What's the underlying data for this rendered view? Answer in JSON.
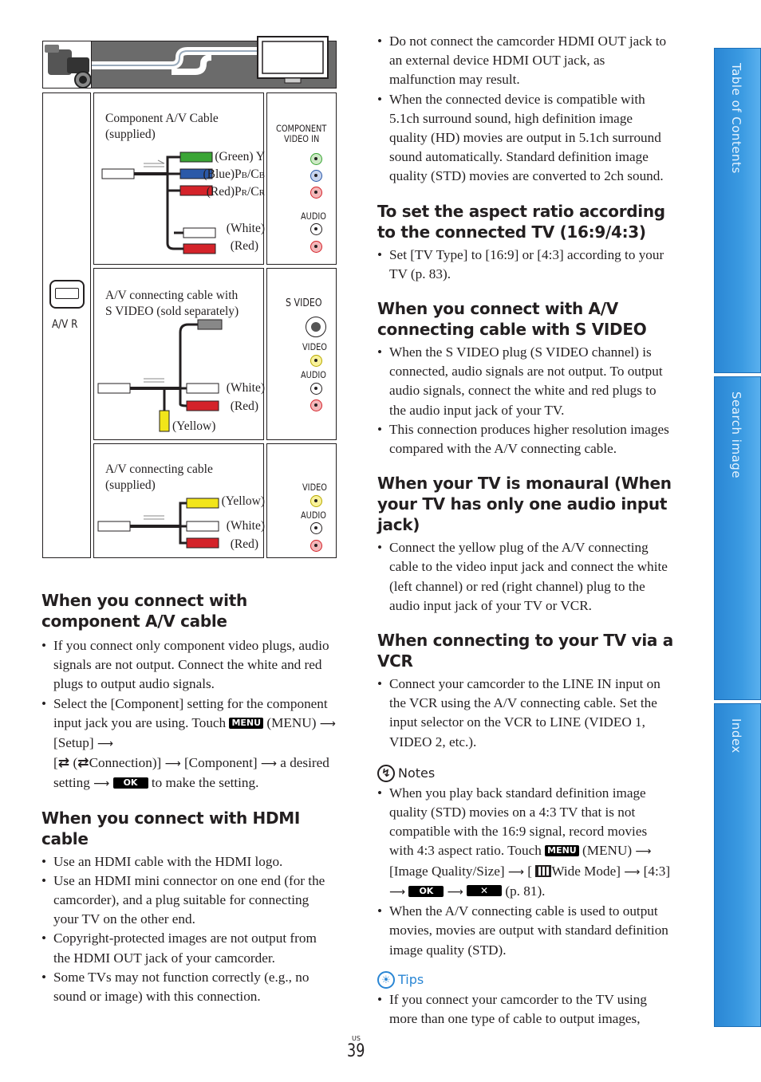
{
  "diagram": {
    "camcorder_jack": "A/V R",
    "component": {
      "cable_label_1": "Component A/V Cable",
      "cable_label_2": "(supplied)",
      "tv_label_1": "COMPONENT",
      "tv_label_2": "VIDEO IN",
      "audio_label": "AUDIO",
      "plugs": [
        "(Green) Y",
        "(Blue)P",
        "B",
        "/C",
        "B",
        "(Red)P",
        "R",
        "/C",
        "R",
        "(White)",
        "(Red)"
      ]
    },
    "svideo": {
      "cable_label_1": "A/V connecting cable with",
      "cable_label_2": "S VIDEO (sold separately)",
      "tv_svideo": "S VIDEO",
      "tv_video": "VIDEO",
      "tv_audio": "AUDIO",
      "plugs": [
        "(White)",
        "(Red)",
        "(Yellow)"
      ]
    },
    "av": {
      "cable_label_1": "A/V connecting cable",
      "cable_label_2": "(supplied)",
      "tv_video": "VIDEO",
      "tv_audio": "AUDIO",
      "plugs": [
        "(Yellow)",
        "(White)",
        "(Red)"
      ]
    },
    "colors": {
      "green": "#3aa535",
      "blue": "#2b59a8",
      "red": "#d4232a",
      "yellow": "#f2e51a",
      "white": "#ffffff",
      "banner": "#6b6b6b"
    }
  },
  "left": {
    "component": {
      "heading": "When you connect with component A/V cable",
      "b1": "If you connect only component video plugs, audio signals are not output. Connect the white and red plugs to output audio signals.",
      "b2_a": "Select the [Component] setting for the component input jack you are using. Touch",
      "menu": "MENU",
      "b2_b": "(MENU)",
      "b2_c": "[Setup]",
      "b2_d": "[",
      "b2_e": "(",
      "b2_f": "Connection)]",
      "b2_g": "[Component]",
      "b2_h": "a desired setting",
      "ok": "OK",
      "b2_i": "to make the setting."
    },
    "hdmi": {
      "heading": "When you connect with HDMI cable",
      "bullets": [
        "Use an HDMI cable with the HDMI logo.",
        "Use an HDMI mini connector on one end (for the camcorder), and a plug suitable for connecting your TV on the other end.",
        "Copyright-protected images are not output from the HDMI OUT jack of your camcorder.",
        "Some TVs may not function correctly (e.g., no sound or image) with this connection."
      ]
    }
  },
  "right": {
    "top_bullets": [
      "Do not connect the camcorder HDMI OUT jack to an external device HDMI OUT jack, as malfunction may result.",
      "When the connected device is compatible with 5.1ch surround sound, high definition image quality (HD) movies are output in 5.1ch surround sound automatically. Standard definition image quality (STD) movies are converted to 2ch sound."
    ],
    "aspect": {
      "heading": "To set the aspect ratio according to the connected TV (16:9/4:3)",
      "bullets": [
        "Set [TV Type] to [16:9] or [4:3] according to your TV (p. 83)."
      ]
    },
    "svideo": {
      "heading": "When you connect with A/V connecting cable with S VIDEO",
      "bullets": [
        "When the S VIDEO plug (S VIDEO channel) is connected, audio signals are not output. To output audio signals, connect the white and red plugs to the audio input jack of your TV.",
        "This connection produces higher resolution images compared with the A/V connecting cable."
      ]
    },
    "monaural": {
      "heading": "When your TV is monaural (When your TV has only one audio input jack)",
      "bullets": [
        "Connect the yellow plug of the A/V connecting cable to the video input jack and connect the white (left channel) or red (right channel) plug to the audio input jack of your TV or VCR."
      ]
    },
    "vcr": {
      "heading": "When connecting to your TV via a VCR",
      "bullets": [
        "Connect your camcorder to the LINE IN input on the VCR using the A/V connecting cable. Set the input selector on the VCR to LINE (VIDEO 1, VIDEO 2, etc.)."
      ]
    },
    "notes": {
      "heading": "Notes",
      "n1_a": "When you play back standard definition image quality (STD) movies on a 4:3 TV that is not compatible with the 16:9 signal, record movies with 4:3 aspect ratio. Touch",
      "menu": "MENU",
      "n1_b": "(MENU)",
      "n1_c": "[Image Quality/Size]",
      "n1_d": "[",
      "n1_e": "Wide Mode]",
      "n1_f": "[4:3]",
      "ok": "OK",
      "x": "✕",
      "n1_g": "(p. 81).",
      "n2": "When the A/V connecting cable is used to output movies, movies are output with standard definition image quality (STD)."
    },
    "tips": {
      "heading": "Tips",
      "t1": "If you connect your camcorder to the TV using more than one type of cable to output images,"
    }
  },
  "page": {
    "region": "US",
    "number": "39"
  },
  "side_tabs": [
    "Table of Contents",
    "Search image",
    "Index"
  ],
  "accent_color": "#2a86d4"
}
